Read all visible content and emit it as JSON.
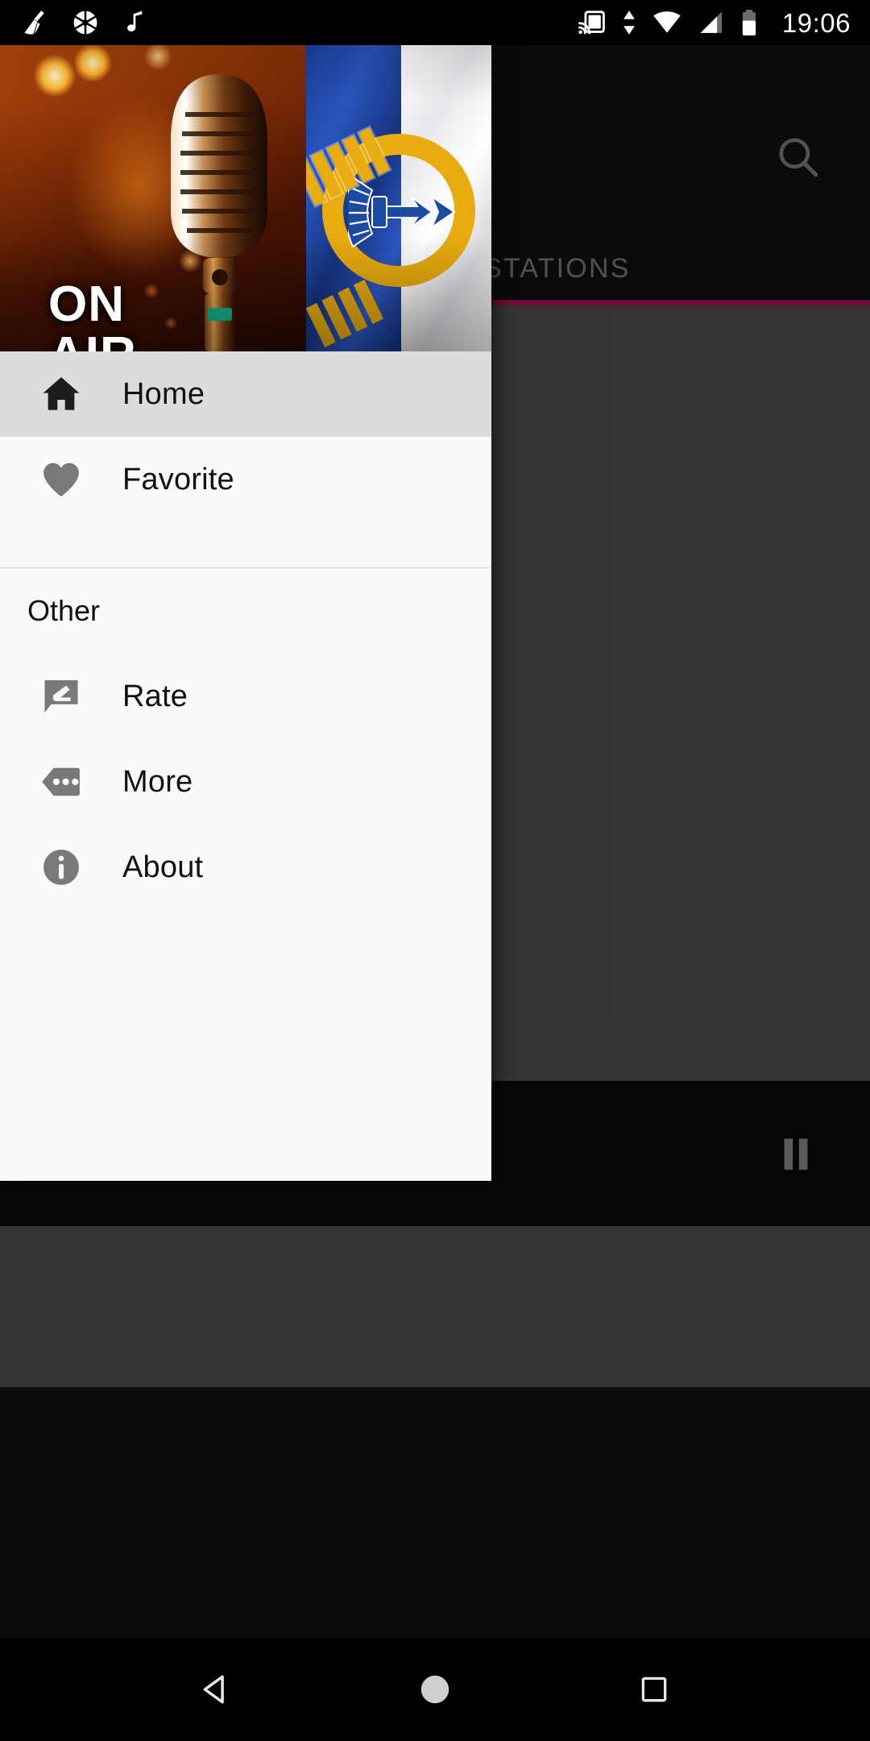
{
  "status_bar": {
    "time": "19:06",
    "left_icons": [
      "cleaner-broom-icon",
      "camera-aperture-icon",
      "music-note-icon"
    ],
    "right_icons": [
      "cast-icon",
      "data-transfer-icon",
      "wifi-icon",
      "signal-icon",
      "battery-icon"
    ]
  },
  "app": {
    "search_icon": "search-icon",
    "tab_label": "STATIONS",
    "tab_indicator_color": "#c2185b",
    "player": {
      "pause_icon": "pause-icon"
    }
  },
  "drawer": {
    "header": {
      "on_air_line1": "ON",
      "on_air_line2": "AIR",
      "image_alt": "retro-microphone-with-flag"
    },
    "items": [
      {
        "label": "Home",
        "icon": "home-icon",
        "selected": true
      },
      {
        "label": "Favorite",
        "icon": "heart-icon",
        "selected": false
      }
    ],
    "section_title": "Other",
    "other_items": [
      {
        "label": "Rate",
        "icon": "rate-comment-edit-icon"
      },
      {
        "label": "More",
        "icon": "more-tag-icon"
      },
      {
        "label": "About",
        "icon": "info-circle-icon"
      }
    ]
  },
  "nav_bar": {
    "back": "back-triangle-icon",
    "home": "home-circle-icon",
    "recents": "recents-square-icon"
  },
  "colors": {
    "accent": "#c2185b",
    "drawer_bg": "#fafafa",
    "selected_row": "#dcdcdc",
    "icon_gray": "#7b7b7b"
  }
}
